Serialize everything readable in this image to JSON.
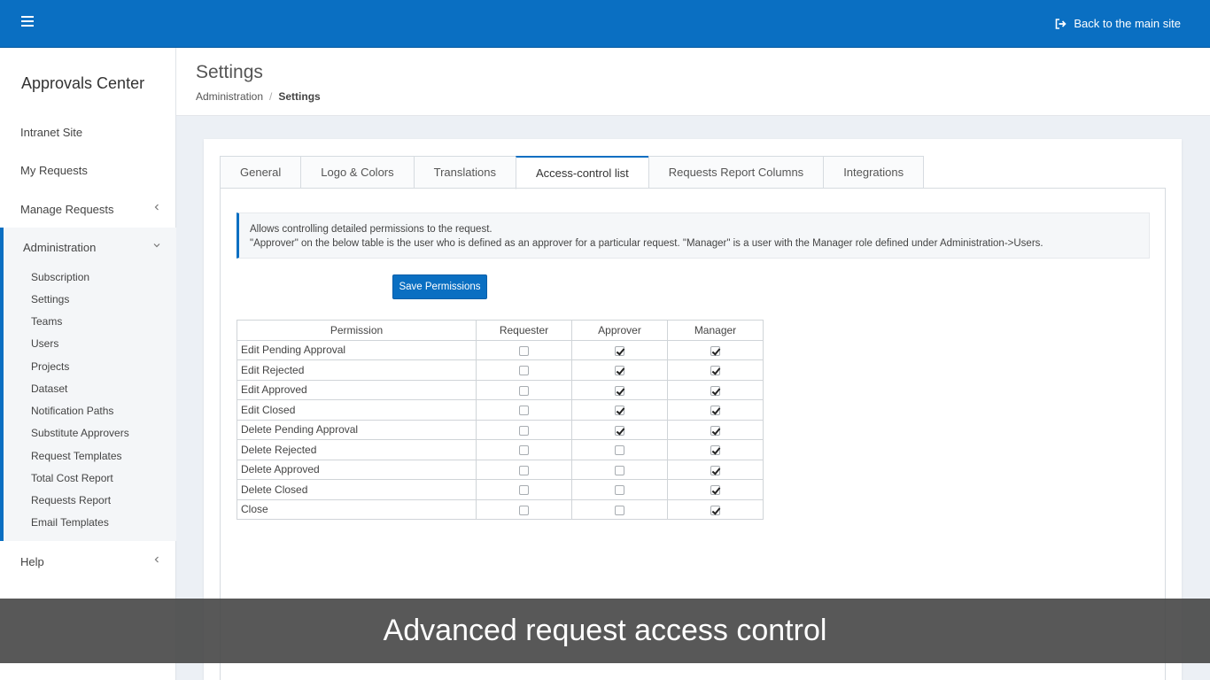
{
  "topbar": {
    "back_label": "Back to the main site"
  },
  "sidebar": {
    "brand": "Approvals Center",
    "items": [
      {
        "label": "Intranet Site"
      },
      {
        "label": "My Requests"
      },
      {
        "label": "Manage Requests"
      }
    ],
    "group": {
      "label": "Administration",
      "items": [
        "Subscription",
        "Settings",
        "Teams",
        "Users",
        "Projects",
        "Dataset",
        "Notification Paths",
        "Substitute Approvers",
        "Request Templates",
        "Total Cost Report",
        "Requests Report",
        "Email Templates"
      ]
    },
    "help": "Help"
  },
  "header": {
    "title": "Settings",
    "breadcrumb": {
      "parent": "Administration",
      "sep": "/",
      "current": "Settings"
    }
  },
  "tabs": [
    "General",
    "Logo & Colors",
    "Translations",
    "Access-control list",
    "Requests Report Columns",
    "Integrations"
  ],
  "info": {
    "line1": "Allows controlling detailed permissions to the request.",
    "line2": "\"Approver\" on the below table is the user who is defined as an approver for a particular request. \"Manager\" is a user with the Manager role defined under Administration->Users."
  },
  "save_label": "Save Permissions",
  "table": {
    "headers": [
      "Permission",
      "Requester",
      "Approver",
      "Manager"
    ],
    "rows": [
      {
        "name": "Edit Pending Approval",
        "requester": false,
        "approver": true,
        "manager": true
      },
      {
        "name": "Edit Rejected",
        "requester": false,
        "approver": true,
        "manager": true
      },
      {
        "name": "Edit Approved",
        "requester": false,
        "approver": true,
        "manager": true
      },
      {
        "name": "Edit Closed",
        "requester": false,
        "approver": true,
        "manager": true
      },
      {
        "name": "Delete Pending Approval",
        "requester": false,
        "approver": true,
        "manager": true
      },
      {
        "name": "Delete Rejected",
        "requester": false,
        "approver": false,
        "manager": true
      },
      {
        "name": "Delete Approved",
        "requester": false,
        "approver": false,
        "manager": true
      },
      {
        "name": "Delete Closed",
        "requester": false,
        "approver": false,
        "manager": true
      },
      {
        "name": "Close",
        "requester": false,
        "approver": false,
        "manager": true
      }
    ]
  },
  "caption": "Advanced request access control"
}
